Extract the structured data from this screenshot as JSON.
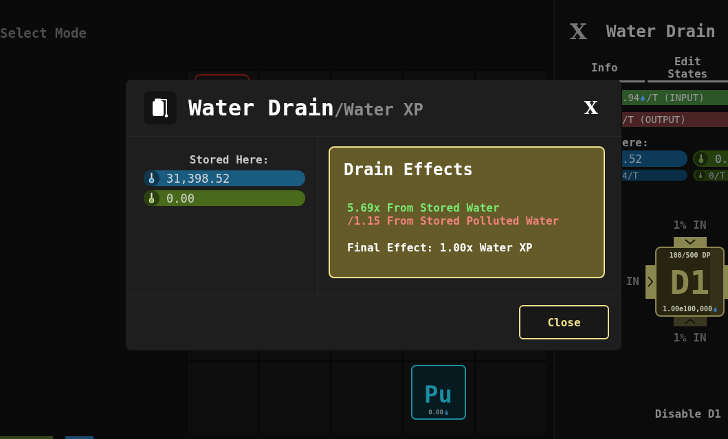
{
  "mode_label": "Select Mode",
  "grid": {
    "tiles": [
      {
        "color": "#6a1414"
      },
      {
        "symbol": "Pu",
        "amount": "0.00",
        "color": "#1b8da1"
      }
    ]
  },
  "side_panel": {
    "close": "X",
    "title": "Water Drain",
    "tabs": [
      {
        "label": "Info",
        "selected": false
      },
      {
        "label": "Edit States",
        "selected": false
      }
    ],
    "flows": [
      {
        "kind": "input",
        "value": ".94",
        "unit": "/T (INPUT)"
      },
      {
        "kind": "output",
        "unit": "/T (OUTPUT)"
      }
    ],
    "stored_label": "ere:",
    "stored": [
      {
        "amount": ".52",
        "rate": "4/T",
        "color": "#0d3a58"
      },
      {
        "amount": "0.",
        "rate": "0/T",
        "color": "#28400f"
      }
    ],
    "node": {
      "name": "D1",
      "durability": "100/500 DP",
      "capacity": "1.00e100,000",
      "ports": [
        {
          "kind": "top",
          "label": "1% IN",
          "active": true
        },
        {
          "kind": "left",
          "label": "IN",
          "active": true
        },
        {
          "kind": "bottom",
          "label": "1% IN",
          "active": false
        },
        {
          "kind": "right",
          "active": true
        }
      ]
    },
    "disable_button": "Disable D1"
  },
  "dialog": {
    "title": "Water Drain",
    "subtitle": "/Water XP",
    "close": "X",
    "stored_label": "Stored Here:",
    "stored": [
      {
        "value": "31,398.52",
        "color": "#1a5b80"
      },
      {
        "value": "0.00",
        "color": "#496a1a"
      }
    ],
    "effects": {
      "title": "Drain Effects",
      "lines": [
        {
          "kind": "bonus",
          "text": "5.69x From Stored Water"
        },
        {
          "kind": "penalty",
          "text": "/1.15 From Stored Polluted Water"
        },
        {
          "kind": "total",
          "text": "Final Effect: 1.00x Water XP"
        }
      ]
    },
    "close_button": "Close"
  }
}
